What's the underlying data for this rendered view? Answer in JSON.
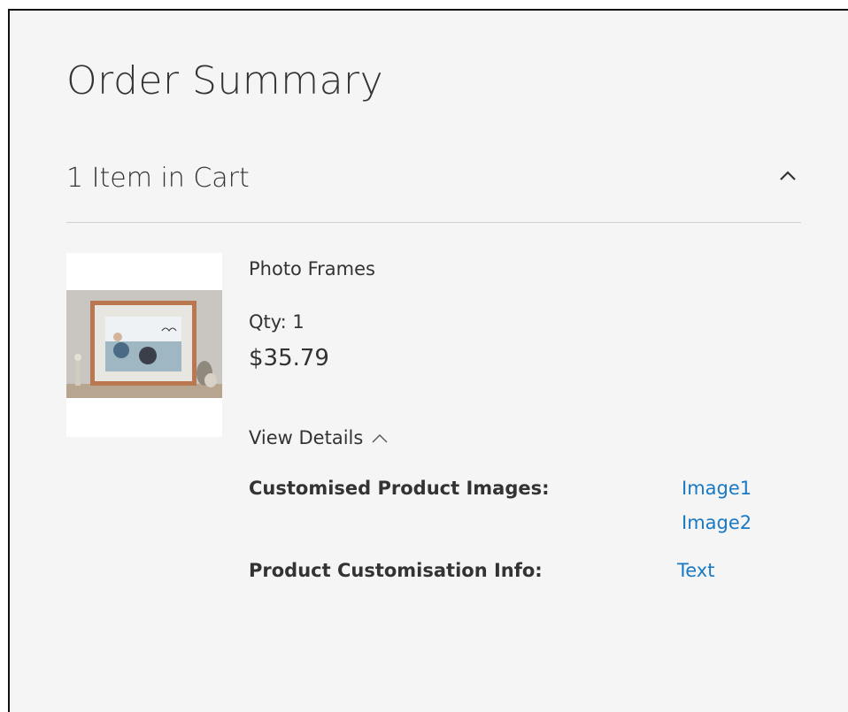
{
  "summary": {
    "title": "Order Summary",
    "items_in_cart": "1 Item in Cart",
    "toggle_icon": "chevron-up-icon"
  },
  "item": {
    "name": "Photo Frames",
    "qty": "Qty: 1",
    "price": "$35.79",
    "view_details": "View Details",
    "options": [
      {
        "label": "Customised Product Images:",
        "values": [
          "Image1",
          "Image2"
        ]
      },
      {
        "label": "Product Customisation Info:",
        "values": [
          "Text"
        ]
      }
    ]
  },
  "colors": {
    "background": "#f5f5f5",
    "text": "#333333",
    "link": "#1979c3",
    "divider": "#cfcfcf"
  }
}
